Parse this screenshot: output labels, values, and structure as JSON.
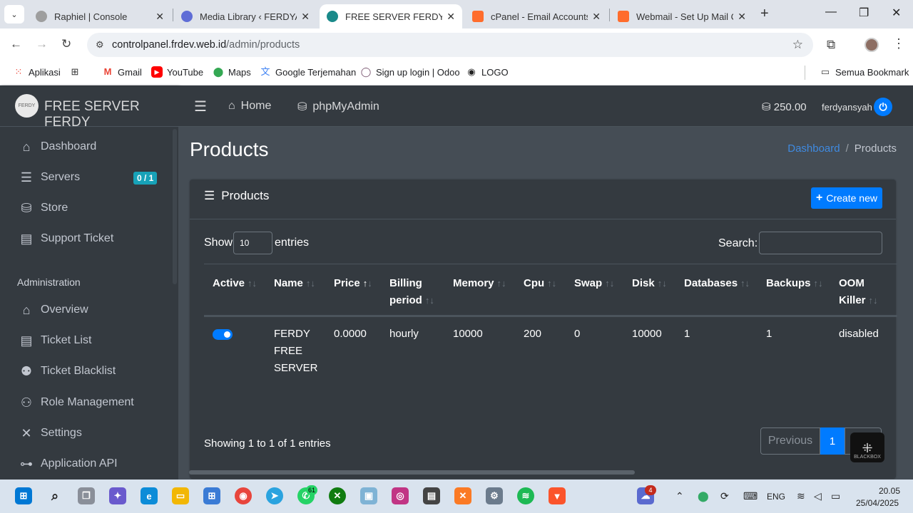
{
  "browser": {
    "tabs": [
      {
        "title": "Raphiel | Console",
        "color": "#9e9e9e"
      },
      {
        "title": "Media Library ‹ FERDYANSYAH",
        "color": "#5f6dd6"
      },
      {
        "title": "FREE SERVER FERDY",
        "color": "#1a8a8a"
      },
      {
        "title": "cPanel - Email Accounts",
        "color": "#ff6c2c"
      },
      {
        "title": "Webmail - Set Up Mail Client",
        "color": "#ff6c2c"
      }
    ],
    "url_host": "controlpanel.frdev.web.id",
    "url_path": "/admin/products",
    "bookmarks": [
      "Aplikasi",
      "Gmail",
      "YouTube",
      "Maps",
      "Google Terjemahan",
      "Sign up login | Odoo",
      "LOGO"
    ],
    "all_bookmarks": "Semua Bookmark"
  },
  "brand": {
    "logo_text": "FERDY",
    "name": "FREE SERVER FERDY"
  },
  "sidebar": {
    "items": [
      {
        "label": "Dashboard",
        "icon": "home-icon"
      },
      {
        "label": "Servers",
        "icon": "server-icon"
      },
      {
        "label": "Store",
        "icon": "coins-icon"
      },
      {
        "label": "Support Ticket",
        "icon": "ticket-icon"
      }
    ],
    "servers_badge": "0 / 1",
    "admin_header": "Administration",
    "admin_items": [
      {
        "label": "Overview",
        "icon": "home-icon"
      },
      {
        "label": "Ticket List",
        "icon": "ticket-icon"
      },
      {
        "label": "Ticket Blacklist",
        "icon": "user-block-icon"
      },
      {
        "label": "Role Management",
        "icon": "user-edit-icon"
      },
      {
        "label": "Settings",
        "icon": "tools-icon"
      },
      {
        "label": "Application API",
        "icon": "gamepad-icon"
      }
    ]
  },
  "topnav": {
    "home": "Home",
    "phpmyadmin": "phpMyAdmin",
    "credits": "250.00",
    "username": "ferdyansyah"
  },
  "page": {
    "title": "Products",
    "breadcrumb": [
      "Dashboard",
      "Products"
    ]
  },
  "card": {
    "title": "Products",
    "create_button": "Create new",
    "show_label": "Show",
    "entries_value": "10",
    "entries_label": "entries",
    "search_label": "Search:",
    "search_value": ""
  },
  "table": {
    "columns": [
      {
        "line1": "",
        "line2": "Active"
      },
      {
        "line1": "",
        "line2": "Name"
      },
      {
        "line1": "",
        "line2": "Price"
      },
      {
        "line1": "Billing",
        "line2": "period"
      },
      {
        "line1": "",
        "line2": "Memory"
      },
      {
        "line1": "",
        "line2": "Cpu"
      },
      {
        "line1": "",
        "line2": "Swap"
      },
      {
        "line1": "",
        "line2": "Disk"
      },
      {
        "line1": "",
        "line2": "Databases"
      },
      {
        "line1": "",
        "line2": "Backups"
      },
      {
        "line1": "OOM",
        "line2": "Killer"
      }
    ],
    "sorted_column": "Price",
    "rows": [
      {
        "active": true,
        "name_lines": [
          "FERDY",
          "FREE",
          "SERVER"
        ],
        "price": "0.0000",
        "billing_period": "hourly",
        "memory": "10000",
        "cpu": "200",
        "swap": "0",
        "disk": "10000",
        "databases": "1",
        "backups": "1",
        "oom_killer": "disabled"
      }
    ],
    "info": "Showing 1 to 1 of 1 entries",
    "pager": {
      "previous": "Previous",
      "current": "1"
    }
  },
  "overlay": {
    "blackbox_label": "BLACKBOX"
  },
  "taskbar": {
    "language": "ENG",
    "time": "20.05",
    "date": "25/04/2025",
    "whatsapp_badge": "61",
    "notif_badge": "4"
  },
  "colors": {
    "accent": "#007bff",
    "sidebar_bg": "#343a40",
    "content_bg": "#454d55",
    "badge": "#17a2b8"
  }
}
